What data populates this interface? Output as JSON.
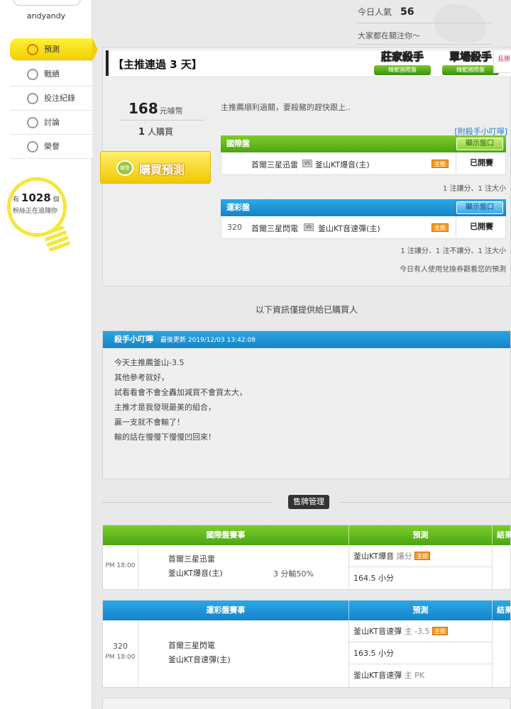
{
  "sidebar": {
    "username": "andyandy",
    "nav": [
      {
        "label": "預測",
        "icon": "target-icon"
      },
      {
        "label": "戰績",
        "icon": "chart-icon"
      },
      {
        "label": "投注紀錄",
        "icon": "record-icon"
      },
      {
        "label": "討論",
        "icon": "discussion-icon"
      },
      {
        "label": "榮譽",
        "icon": "honor-icon"
      }
    ],
    "fans": {
      "prefix": "有",
      "count": "1028",
      "unit": "個",
      "text": "粉絲正在追隨你"
    }
  },
  "header": {
    "popularity_label": "今日人氣",
    "popularity_value": "56",
    "watching_text": "大家都在關注你～"
  },
  "prediction": {
    "title": "【主推連過 3 天】",
    "badge1_top": "莊家殺手",
    "badge1_bottom": "韓籃國際盤",
    "badge2_top": "單場殺手",
    "badge2_bottom": "韓籃國際盤",
    "ribbon": "長勝",
    "price": "168",
    "price_unit": "元噱幣",
    "buyers_count": "1",
    "buyers_label": "人購買",
    "buy_button": "購買預測",
    "coin_icon_label": "噱幣",
    "intro": "主推薦順利過關，要殺豬的趕快跟上..",
    "tip_link": "[附殺手小叮嚀]",
    "markets": [
      {
        "name": "國際盤",
        "show_button": "顯示盤口",
        "code": "",
        "home": "首爾三星迅雷",
        "vs": "VS",
        "away": "釜山KT爆音(主)",
        "tag": "主推",
        "state": "已開賽",
        "summary": "1 注讓分、1 注大小"
      },
      {
        "name": "運彩盤",
        "show_button": "顯示盤口",
        "code": "320",
        "home": "首爾三星閃電",
        "vs": "VS",
        "away": "釜山KT音速彈(主)",
        "tag": "主推",
        "state": "已開賽",
        "summary": "1 注讓分、1 注不讓分、1 注大小"
      }
    ],
    "today_note": "今日有人使用兌換券觀看您的預測"
  },
  "notice": "以下資訊僅提供給已購買人",
  "tips": {
    "title": "殺手小叮嚀",
    "updated": "最後更新 2019/12/03 13:42:08",
    "lines": [
      "今天主推薦釜山-3.5",
      "其他參考就好，",
      "試看看會不會全轟加減買不會買太大，",
      "主推才是我發現最美的組合，",
      "贏一支就不會輸了！",
      "輸的話在慢慢下慢慢凹回來！"
    ]
  },
  "sale_button": "售牌管理",
  "intl_table": {
    "headers": [
      "國際盤賽事",
      "預測",
      "結果"
    ],
    "time": "PM 18:00",
    "team1": "首爾三星迅雷",
    "team2": "釜山KT爆音(主)",
    "loss": "3 分輸50%",
    "preds": [
      {
        "text": "釜山KT爆音",
        "extra": "讓分",
        "tag": "主推"
      },
      {
        "text": "164.5 小分",
        "extra": "",
        "tag": ""
      }
    ]
  },
  "sports_table": {
    "headers": [
      "運彩盤賽事",
      "預測",
      "結果"
    ],
    "code": "320",
    "time": "PM 18:00",
    "team1": "首爾三星閃電",
    "team2": "釜山KT音速彈(主)",
    "preds": [
      {
        "text": "釜山KT音速彈",
        "extra": "主 -3.5",
        "tag": "主推"
      },
      {
        "text": "163.5 小分",
        "extra": "",
        "tag": ""
      },
      {
        "text": "釜山KT音速彈",
        "extra": "主 PK",
        "tag": ""
      }
    ]
  }
}
